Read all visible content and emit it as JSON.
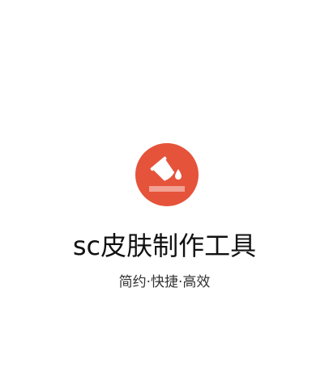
{
  "splash": {
    "logo_icon": "paint-bucket-icon",
    "logo_color": "#e5533b",
    "app_title": "sc皮肤制作工具",
    "slogan": "简约·快捷·高效"
  }
}
